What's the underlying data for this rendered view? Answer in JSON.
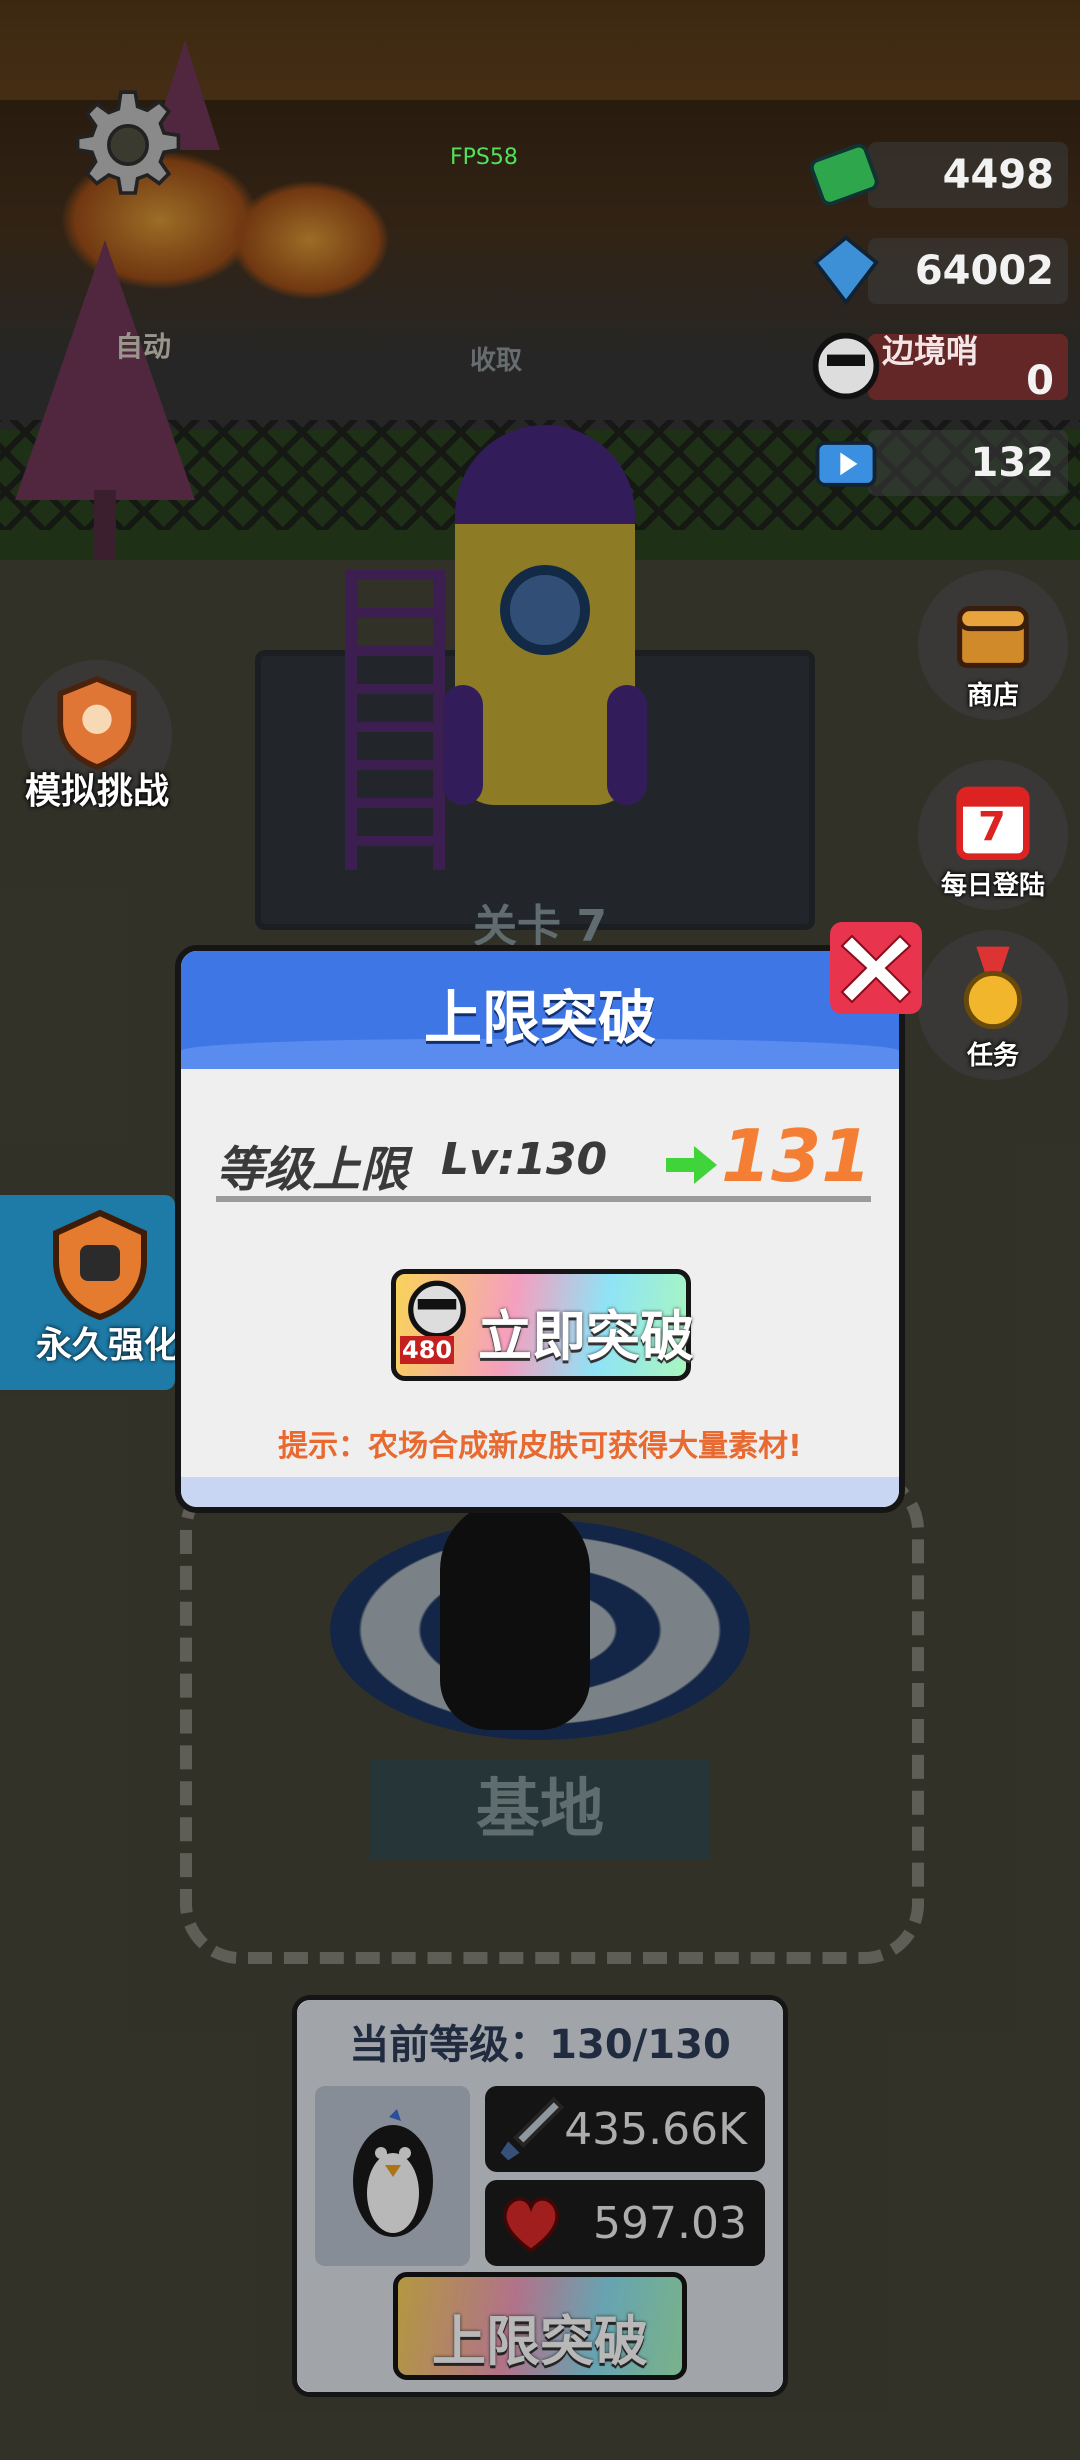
{
  "hud": {
    "fps": "FPS58",
    "resources": [
      {
        "name": "cash",
        "icon": "cash-icon",
        "value": "4498"
      },
      {
        "name": "gems",
        "icon": "gem-icon",
        "value": "64002"
      },
      {
        "name": "border-currency",
        "icon": "skull-badge-icon",
        "value": "0",
        "banner": "边境哨"
      },
      {
        "name": "video",
        "icon": "tv-icon",
        "value": "132"
      }
    ],
    "shop_label": "商店",
    "daily_label": "每日登陆",
    "daily_day": "7",
    "task_label": "任务",
    "sim_label": "模拟挑战",
    "forever_label": "永久强化"
  },
  "scene": {
    "stage_label": "关卡 7",
    "base_label": "基地",
    "collect_label": "收取",
    "auto_label": "自动"
  },
  "modal": {
    "title": "上限突破",
    "level_label": "等级上限",
    "level_current": "Lv:130",
    "level_next": "131",
    "break_button": "立即突破",
    "break_cost": "480",
    "tip": "提示：农场合成新皮肤可获得大量素材!"
  },
  "panel": {
    "title": "当前等级：130/130",
    "attack": "435.66K",
    "health": "597.03",
    "limit_button": "上限突破"
  },
  "colors": {
    "modal_header": "#3f76e6",
    "next_level": "#f47f34",
    "tip": "#e86a31",
    "close": "#e8344d"
  }
}
